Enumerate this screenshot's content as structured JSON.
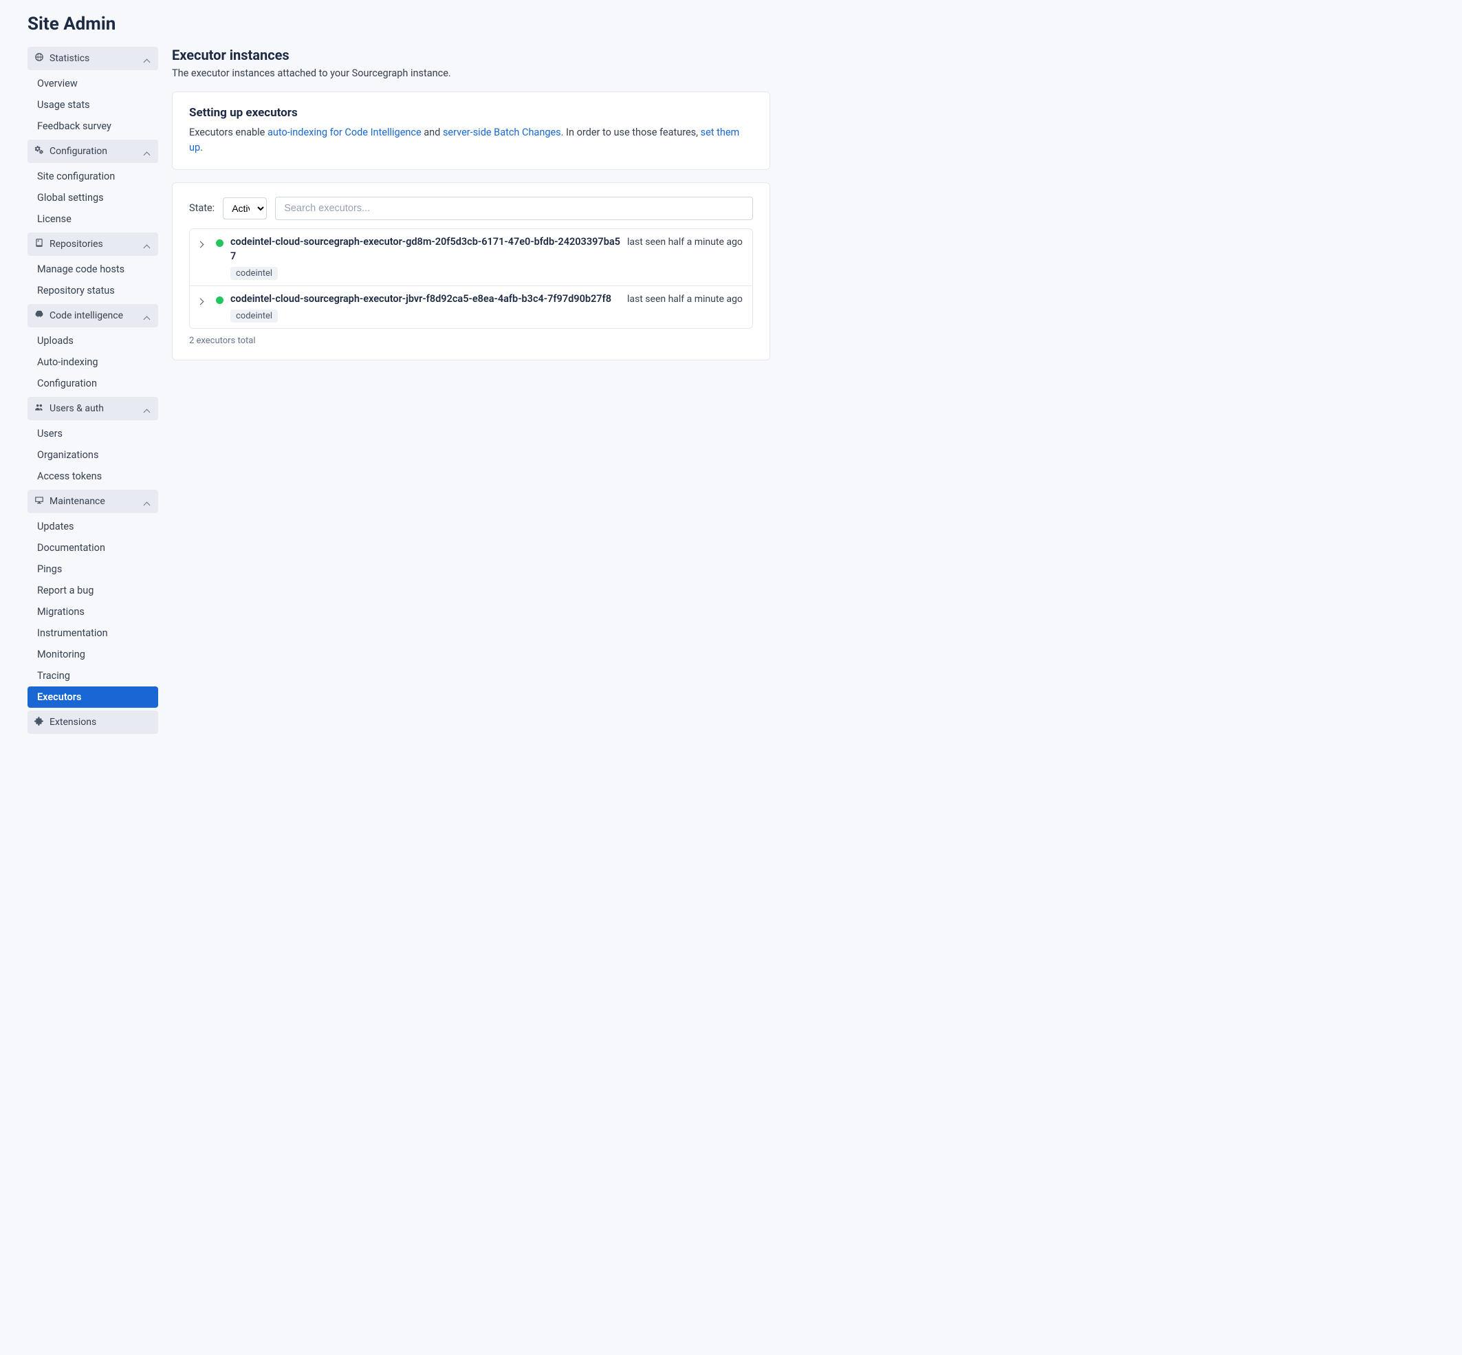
{
  "page_title": "Site Admin",
  "sidebar": {
    "sections": [
      {
        "label": "Statistics",
        "items": [
          {
            "label": "Overview"
          },
          {
            "label": "Usage stats"
          },
          {
            "label": "Feedback survey"
          }
        ]
      },
      {
        "label": "Configuration",
        "items": [
          {
            "label": "Site configuration"
          },
          {
            "label": "Global settings"
          },
          {
            "label": "License"
          }
        ]
      },
      {
        "label": "Repositories",
        "items": [
          {
            "label": "Manage code hosts"
          },
          {
            "label": "Repository status"
          }
        ]
      },
      {
        "label": "Code intelligence",
        "items": [
          {
            "label": "Uploads"
          },
          {
            "label": "Auto-indexing"
          },
          {
            "label": "Configuration"
          }
        ]
      },
      {
        "label": "Users & auth",
        "items": [
          {
            "label": "Users"
          },
          {
            "label": "Organizations"
          },
          {
            "label": "Access tokens"
          }
        ]
      },
      {
        "label": "Maintenance",
        "items": [
          {
            "label": "Updates"
          },
          {
            "label": "Documentation"
          },
          {
            "label": "Pings"
          },
          {
            "label": "Report a bug"
          },
          {
            "label": "Migrations"
          },
          {
            "label": "Instrumentation"
          },
          {
            "label": "Monitoring"
          },
          {
            "label": "Tracing"
          },
          {
            "label": "Executors",
            "active": true
          }
        ]
      },
      {
        "label": "Extensions",
        "items": []
      }
    ]
  },
  "main": {
    "heading": "Executor instances",
    "subheading": "The executor instances attached to your Sourcegraph instance.",
    "setup_card": {
      "title": "Setting up executors",
      "text_prefix": "Executors enable ",
      "link1": "auto-indexing for Code Intelligence",
      "text_mid": " and ",
      "link2": "server-side Batch Changes",
      "text_after": ". In order to use those features, ",
      "link3": "set them up",
      "text_end": "."
    },
    "filter": {
      "state_label": "State:",
      "state_value": "Active",
      "search_placeholder": "Search executors..."
    },
    "executors": [
      {
        "status": "active",
        "name": "codeintel-cloud-sourcegraph-executor-gd8m-20f5d3cb-6171-47e0-bfdb-24203397ba57",
        "tag": "codeintel",
        "last_seen": "last seen half a minute ago"
      },
      {
        "status": "active",
        "name": "codeintel-cloud-sourcegraph-executor-jbvr-f8d92ca5-e8ea-4afb-b3c4-7f97d90b27f8",
        "tag": "codeintel",
        "last_seen": "last seen half a minute ago"
      }
    ],
    "footer": "2 executors total"
  }
}
